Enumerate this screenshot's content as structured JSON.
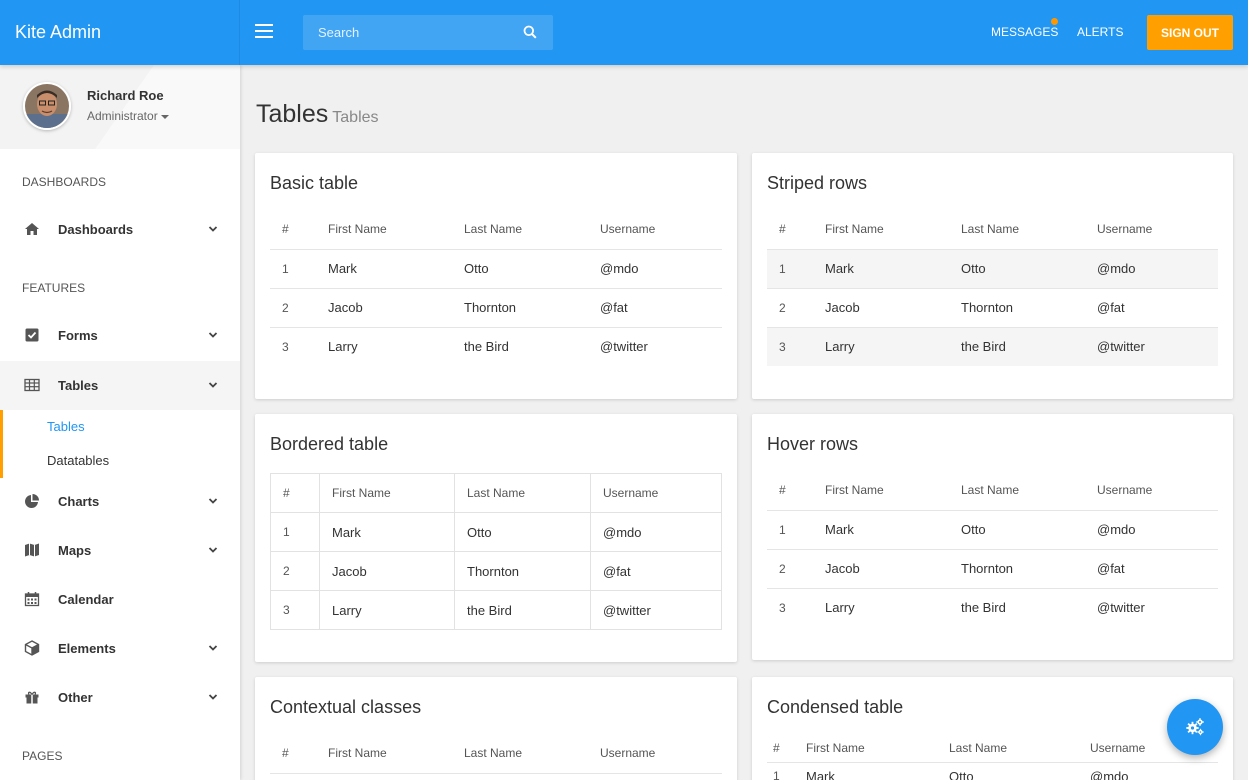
{
  "brand": "Kite Admin",
  "search": {
    "placeholder": "Search"
  },
  "nav": {
    "messages": "MESSAGES",
    "alerts": "ALERTS",
    "signout": "SIGN OUT"
  },
  "colors": {
    "primary": "#2196f3",
    "accent": "#ffa000"
  },
  "profile": {
    "name": "Richard Roe",
    "role": "Administrator"
  },
  "sidebar": {
    "sections": [
      "DASHBOARDS",
      "FEATURES",
      "PAGES"
    ],
    "items": [
      {
        "label": "Dashboards",
        "icon": "home-icon"
      },
      {
        "label": "Forms",
        "icon": "checkbox-icon"
      },
      {
        "label": "Tables",
        "icon": "table-icon"
      },
      {
        "label": "Charts",
        "icon": "pie-chart-icon"
      },
      {
        "label": "Maps",
        "icon": "map-icon"
      },
      {
        "label": "Calendar",
        "icon": "calendar-icon"
      },
      {
        "label": "Elements",
        "icon": "cube-icon"
      },
      {
        "label": "Other",
        "icon": "gift-icon"
      }
    ],
    "submenu": [
      "Tables",
      "Datatables"
    ]
  },
  "page": {
    "title": "Tables",
    "subtitle": "Tables"
  },
  "columns": [
    "#",
    "First Name",
    "Last Name",
    "Username"
  ],
  "rows": [
    [
      "1",
      "Mark",
      "Otto",
      "@mdo"
    ],
    [
      "2",
      "Jacob",
      "Thornton",
      "@fat"
    ],
    [
      "3",
      "Larry",
      "the Bird",
      "@twitter"
    ]
  ],
  "cards": {
    "basic": "Basic table",
    "striped": "Striped rows",
    "bordered": "Bordered table",
    "hover": "Hover rows",
    "contextual": "Contextual classes",
    "condensed": "Condensed table"
  }
}
